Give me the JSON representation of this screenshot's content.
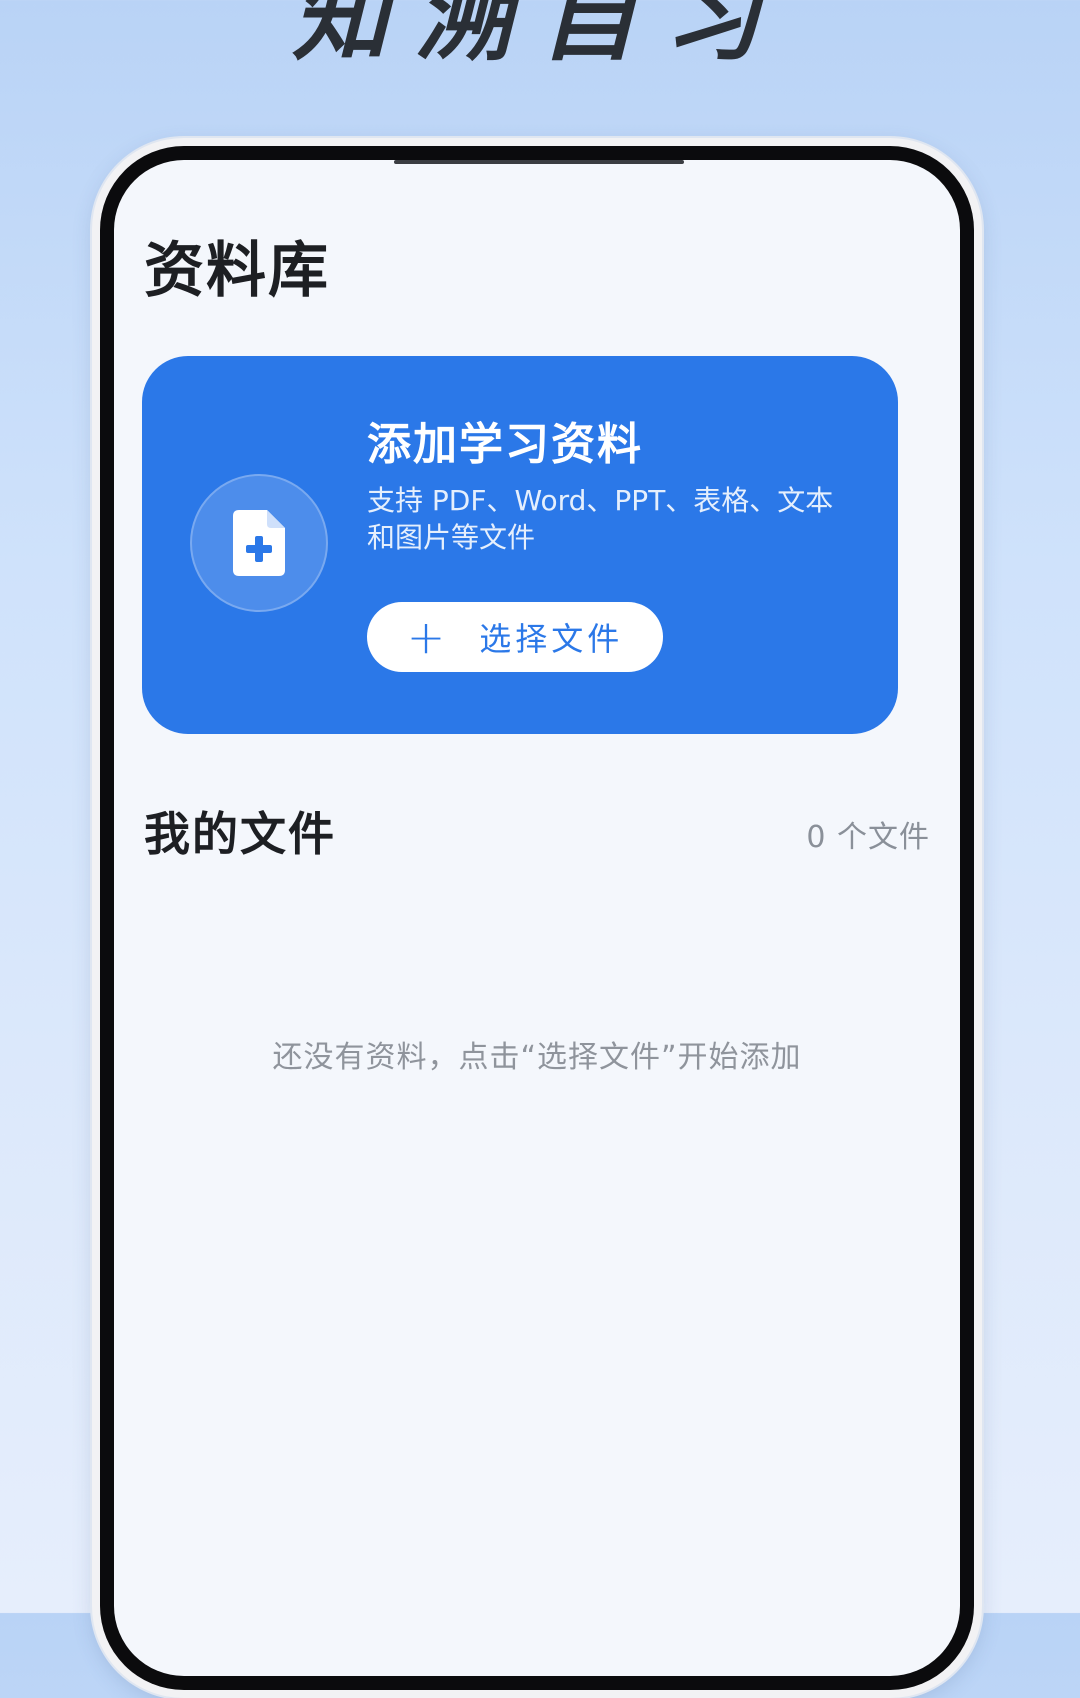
{
  "banner": {
    "title": "知溯自习"
  },
  "page": {
    "title": "资料库"
  },
  "upload_card": {
    "title": "添加学习资料",
    "description": "支持 PDF、Word、PPT、表格、文本和图片等文件",
    "button_label": "选择文件",
    "icon": "file-plus-icon",
    "button_icon": "plus-icon"
  },
  "files_section": {
    "title": "我的文件",
    "count": "0 个文件",
    "empty_hint": "还没有资料，点击“选择文件”开始添加"
  },
  "colors": {
    "accent": "#2b78e8",
    "background": "#f4f7fc",
    "text_primary": "#1d1f23",
    "text_muted": "#8f949c"
  }
}
